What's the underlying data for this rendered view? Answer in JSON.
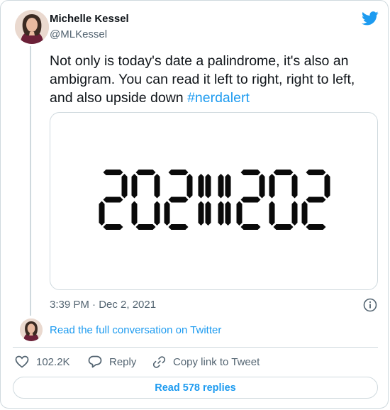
{
  "tweet": {
    "author_name": "Michelle Kessel",
    "author_handle": "@MLKessel",
    "text_main": "Not only is today's date a palindrome, it's also an ambigram. You can read it left to right, right to left, and also upside down ",
    "hashtag": "#nerdalert",
    "media_digits": "20211202",
    "timestamp": "3:39 PM · Dec 2, 2021"
  },
  "links": {
    "read_conversation": "Read the full conversation on Twitter"
  },
  "actions": {
    "like_count": "102.2K",
    "reply_label": "Reply",
    "copy_link_label": "Copy link to Tweet"
  },
  "footer": {
    "read_replies_label": "Read 578 replies"
  },
  "icons": {
    "brand": "twitter-bird-icon",
    "info": "info-icon",
    "like": "heart-icon",
    "reply": "speech-bubble-icon",
    "copy": "link-icon"
  },
  "colors": {
    "accent": "#1d9bf0",
    "secondary_text": "#536471",
    "border": "#cfd9de"
  }
}
